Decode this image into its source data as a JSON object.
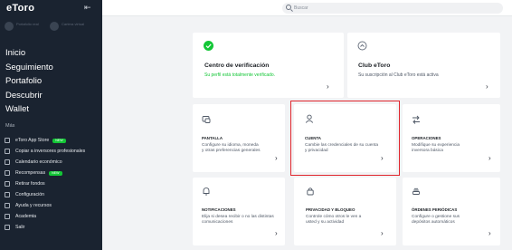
{
  "sidebar": {
    "logo": "eToro",
    "modes": [
      "Portafolio real",
      "Cartera virtual"
    ],
    "main_items": [
      "Inicio",
      "Seguimiento",
      "Portafolio",
      "Descubrir",
      "Wallet"
    ],
    "more_label": "Más",
    "sub_items": [
      {
        "label": "eToro App Store",
        "badge": "NEW",
        "icon": "store-icon"
      },
      {
        "label": "Copiar a inversores profesionales",
        "icon": "copy-icon"
      },
      {
        "label": "Calendario económico",
        "icon": "calendar-icon"
      },
      {
        "label": "Recompensas",
        "badge": "NEW",
        "icon": "gift-icon"
      },
      {
        "label": "Retirar fondos",
        "icon": "withdraw-icon"
      },
      {
        "label": "Configuración",
        "icon": "gear-icon"
      },
      {
        "label": "Ayuda y recursos",
        "icon": "help-icon"
      },
      {
        "label": "Academia",
        "icon": "academy-icon"
      },
      {
        "label": "Salir",
        "icon": "logout-icon"
      }
    ]
  },
  "search": {
    "placeholder": "Buscar"
  },
  "cards": {
    "verification": {
      "title": "Centro de verificación",
      "desc": "Su perfil está totalmente verificado."
    },
    "club": {
      "title": "Club eToro",
      "desc": "Su suscripción al Club eToro está activa"
    },
    "pantalla": {
      "title": "PANTALLA",
      "desc": "Configure su idioma, moneda y otras preferencias generales"
    },
    "cuenta": {
      "title": "CUENTA",
      "desc": "Cambie las credenciales de su cuenta y privacidad"
    },
    "operaciones": {
      "title": "OPERACIONES",
      "desc": "Modifique su experiencia inversora básica"
    },
    "notificaciones": {
      "title": "NOTIFICACIONES",
      "desc": "Elija si desea recibir o no las distintas comunicaciones"
    },
    "privacidad": {
      "title": "PRIVACIDAD Y BLOQUEO",
      "desc": "Controle cómo otros le ven a usted y su actividad"
    },
    "ordenes": {
      "title": "ÓRDENES PERIÓDICAS",
      "desc": "Configure o gestione sus depósitos automáticos"
    }
  },
  "colors": {
    "sidebar": "#1a2330",
    "accent_green": "#13c636",
    "highlight": "#e0252d"
  }
}
